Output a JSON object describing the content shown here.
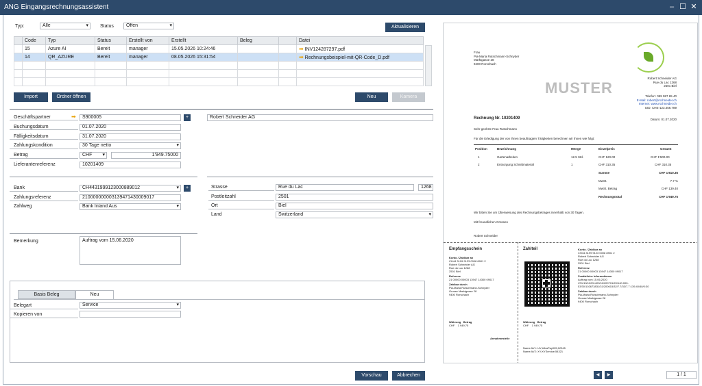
{
  "window": {
    "title": "ANG Eingangsrechnungsassistent",
    "min": "‒",
    "max": "☐",
    "close": "✕"
  },
  "filters": {
    "typ_label": "Typ:",
    "typ_value": "Alle",
    "status_label": "Status",
    "status_value": "Offen",
    "refresh": "Aktualisieren"
  },
  "grid": {
    "headers": [
      "Code",
      "Typ",
      "Status",
      "Erstellt von",
      "Erstellt",
      "Beleg",
      "Datei"
    ],
    "rows": [
      {
        "code": "15",
        "typ": "Azure AI",
        "status": "Bereit",
        "by": "manager",
        "created": "15.05.2026 10:24:46",
        "beleg": "",
        "file": "INV124287297.pdf"
      },
      {
        "code": "14",
        "typ": "QR_AZURE",
        "status": "Bereit",
        "by": "manager",
        "created": "08.05.2026 15:31:54",
        "beleg": "",
        "file": "Rechnungsbeispiel-mit-QR-Code_D.pdf"
      }
    ]
  },
  "actions": {
    "import": "Import",
    "open_folder": "Ordner öffnen",
    "new": "Neu",
    "camera": "Kamera"
  },
  "form": {
    "partner_label": "Geschäftspartner",
    "partner_value": "S900005",
    "partner_name": "Robert Schneider AG",
    "booking_label": "Buchungsdatum",
    "booking_value": "01.07.2020",
    "due_label": "Fälligkeitsdatum",
    "due_value": "31.07.2020",
    "terms_label": "Zahlungskondition",
    "terms_value": "30 Tage netto",
    "amount_label": "Betrag",
    "currency": "CHF",
    "amount_value": "1'949.75000",
    "ref_label": "Lieferantenreferenz",
    "ref_value": "10201409",
    "bank_label": "Bank",
    "bank_value": "CH4431999123000889012",
    "payref_label": "Zahlungsreferenz",
    "payref_value": "210000000003139471430009017",
    "payway_label": "Zahlweg",
    "payway_value": "Bank Inland Aus",
    "street_label": "Strasse",
    "street_value": "Rue du Lac",
    "street_no": "1268",
    "zip_label": "Postleitzahl",
    "zip_value": "2501",
    "city_label": "Ort",
    "city_value": "Biel",
    "country_label": "Land",
    "country_value": "Switzerland",
    "remark_label": "Bemerkung",
    "remark_value": "Auftrag vom 15.06.2020"
  },
  "tabs": {
    "basis": "Basis Beleg",
    "neu": "Neu",
    "doctype_label": "Belegart",
    "doctype_value": "Service",
    "copy_label": "Kopieren von",
    "copy_value": ""
  },
  "footer": {
    "preview": "Vorschau",
    "cancel": "Abbrechen",
    "page": "1 / 1",
    "prev": "◀",
    "next": "▶"
  },
  "doc": {
    "recipient": [
      "Frau",
      "Pia-Maria Rutschmann-Schnyder",
      "Marktgasse 28",
      "9400 Rorschach"
    ],
    "watermark": "MUSTER",
    "sender": [
      "Robert Schneider AG",
      "Rue du Lac 1268",
      "2501 Biel"
    ],
    "contact": [
      "Telefon: 059 987 65 40",
      "E-Mail: robert@rschneider.ch",
      "Internet: www.rschneider.ch",
      "UID: CHE-123.456.789"
    ],
    "invoice_no": "Rechnung Nr. 10201409",
    "date": "Datum: 01.07.2020",
    "greeting": "Sehr geehrte Frau Rutschmann",
    "intro": "Für die Erledigung der von Ihnen beauftragten Tätigkeiten berechnen wir Ihnen wie folgt:",
    "cols": [
      "Position",
      "Bezeichnung",
      "Menge",
      "Einzelpreis",
      "Gesamt"
    ],
    "items": [
      [
        "1",
        "Gartenarbeiten",
        "12.5 Std.",
        "CHF 120.00",
        "CHF 1'500.00"
      ],
      [
        "2",
        "Entsorgung Schnittmaterial",
        "1",
        "CHF 310.35",
        "CHF 310.35"
      ]
    ],
    "sum": [
      "Summe",
      "CHF 1'810.35"
    ],
    "vat": [
      "MwSt.",
      "7.7 %"
    ],
    "vat_amount": [
      "MwSt. Betrag",
      "CHF 139.40"
    ],
    "total": [
      "Rechnungstotal",
      "CHF 1'949.75"
    ],
    "closing": "Wir bitten Sie um Überweisung des Rechnungsbetrages innerhalb von 30 Tagen.",
    "regards": "Mit freundlichen Grüssen",
    "signer": "Robert Schneider",
    "receipt_title": "Empfangsschein",
    "payment_title": "Zahlteil",
    "slip_account": [
      "Konto / Zahlbar an",
      "CH44 3199 9123 0008 8901 2",
      "Robert Schneider AG",
      "Rue du Lac 1268",
      "2501 Biel"
    ],
    "slip_ref": [
      "Referenz",
      "21 00000 00003 13947 14300 09017"
    ],
    "slip_payer": [
      "Zahlbar durch",
      "Pia-Maria Rutschmann-Schnyder",
      "Grosse Marktgasse 28",
      "9400 Rorschach"
    ],
    "slip_currency": [
      "Währung",
      "CHF"
    ],
    "slip_amount": [
      "Betrag",
      "1 949.75"
    ],
    "acceptance": "Annahmestelle",
    "addinfo": [
      "Zusätzliche Informationen",
      "Auftrag vom 15.06.2020",
      "//S1/10/10201409/11/200701/20/140.000-",
      "53/30/102673831/31/200615/32/7.7/33/7.7:139.40/40/0:30"
    ],
    "alt": [
      "Name AV1: UV;UltraPay005;12345",
      "Name AV2: XY;XYService;54321"
    ]
  }
}
